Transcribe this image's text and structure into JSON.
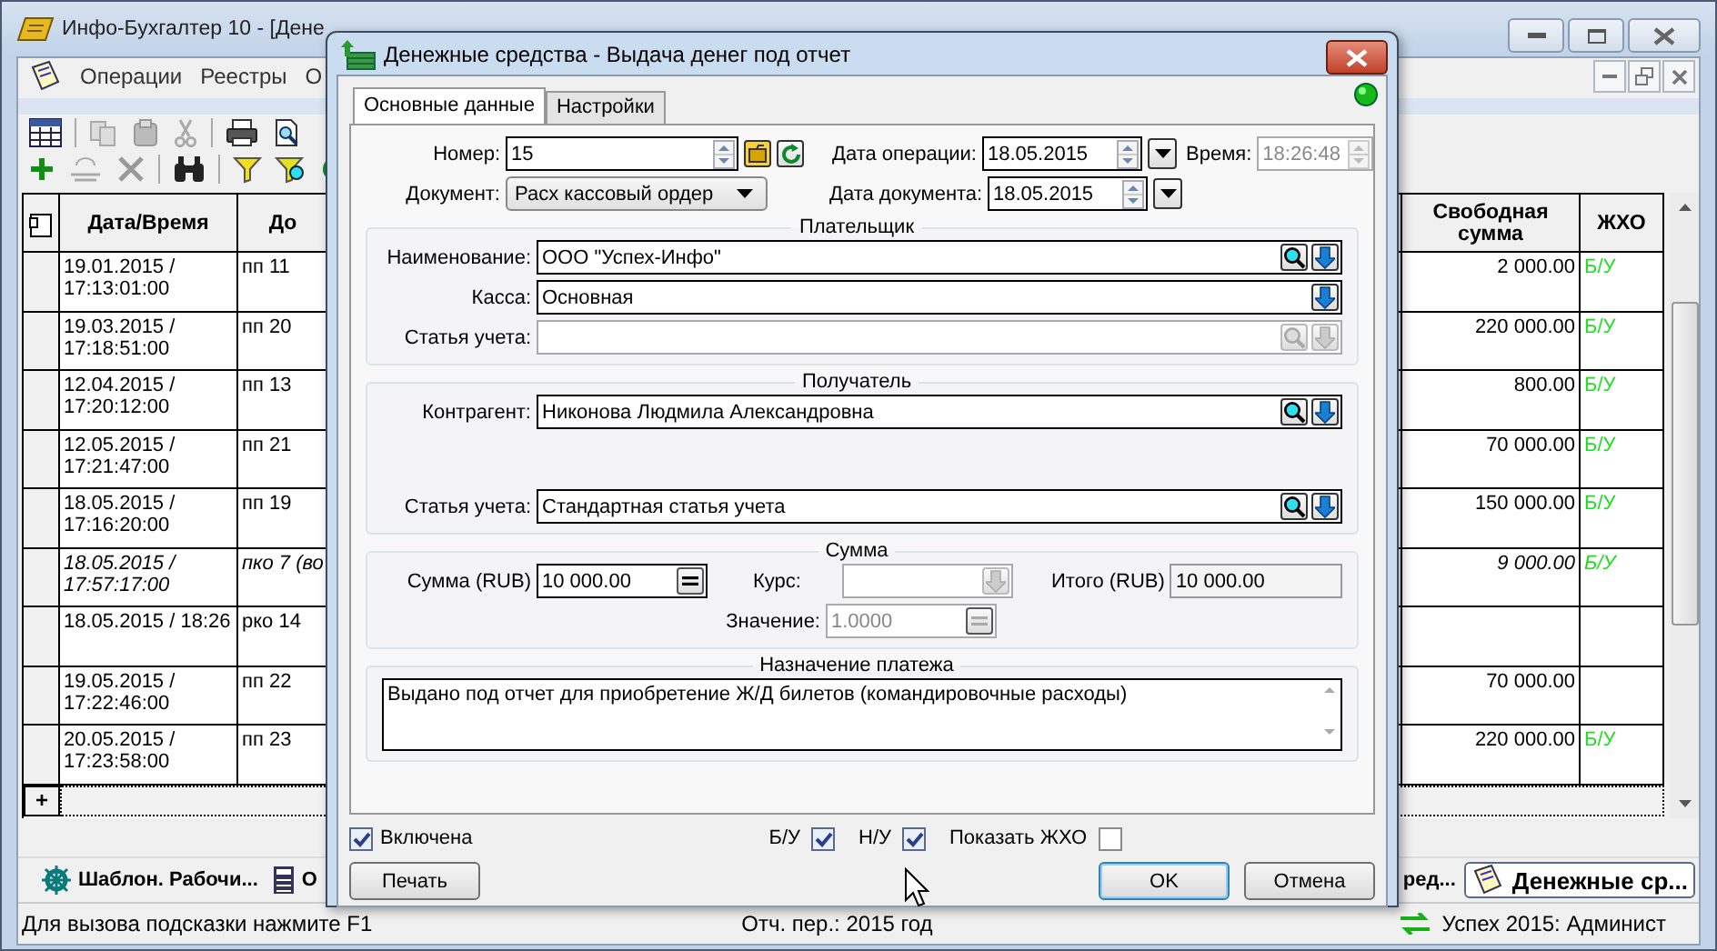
{
  "window": {
    "title": "Инфо-Бухгалтер 10 - [Дене"
  },
  "menu": [
    {
      "label": "Операции"
    },
    {
      "label": "Реестры"
    },
    {
      "label": "О"
    }
  ],
  "grid": {
    "columns": [
      "Дата/Время",
      "До",
      "Свободная сумма",
      "ЖХО"
    ],
    "rows": [
      {
        "datetime": "19.01.2015 / 17:13:01:00",
        "document": "пп 11",
        "free_sum": "2 000.00",
        "jho": "Б/У",
        "italic": false
      },
      {
        "datetime": "19.03.2015 / 17:18:51:00",
        "document": "пп 20",
        "free_sum": "220 000.00",
        "jho": "Б/У",
        "italic": false
      },
      {
        "datetime": "12.04.2015 / 17:20:12:00",
        "document": "пп 13",
        "free_sum": "800.00",
        "jho": "Б/У",
        "italic": false
      },
      {
        "datetime": "12.05.2015 / 17:21:47:00",
        "document": "пп 21",
        "free_sum": "70 000.00",
        "jho": "Б/У",
        "italic": false
      },
      {
        "datetime": "18.05.2015 / 17:16:20:00",
        "document": "пп 19",
        "free_sum": "150 000.00",
        "jho": "Б/У",
        "italic": false
      },
      {
        "datetime": "18.05.2015 / 17:57:17:00",
        "document": "пко 7 (во",
        "free_sum": "9 000.00",
        "jho": "Б/У",
        "italic": true
      },
      {
        "datetime": "18.05.2015 / 18:26",
        "document": "рко 14",
        "italic": false
      },
      {
        "datetime": "19.05.2015 / 17:22:46:00",
        "document": "пп 22",
        "free_sum": "70 000.00",
        "italic": false
      },
      {
        "datetime": "20.05.2015 / 17:23:58:00",
        "document": "пп 23",
        "free_sum": "220 000.00",
        "jho": "Б/У",
        "italic": false
      }
    ],
    "add_row": "+"
  },
  "taskbar": [
    {
      "label": "Шаблон. Рабочи...",
      "selected": false
    },
    {
      "label": "О",
      "selected": false
    },
    {
      "label": "ред...",
      "selected": false
    },
    {
      "label": "Денежные ср...",
      "selected": true
    }
  ],
  "status_bar": {
    "hint": "Для вызова подсказки нажмите F1",
    "period": "Отч. пер.: 2015 год",
    "database": "Успех 2015: Админист"
  },
  "dialog": {
    "title": "Денежные средства - Выдача денег под отчет",
    "tabs": [
      {
        "label": "Основные данные",
        "selected": true
      },
      {
        "label": "Настройки",
        "selected": false
      }
    ],
    "number": {
      "label": "Номер:",
      "value": "15"
    },
    "operation_date": {
      "label": "Дата операции:",
      "value": "18.05.2015"
    },
    "time": {
      "label": "Время:",
      "value": "18:26:48",
      "disabled": true
    },
    "document": {
      "label": "Документ:",
      "value": "Расх кассовый ордер"
    },
    "document_date": {
      "label": "Дата документа:",
      "value": "18.05.2015"
    },
    "payer": {
      "title": "Плательщик",
      "fields": [
        {
          "label": "Наименование:",
          "value": "ООО \"Успех-Инфо\"",
          "search": true,
          "disabled": false
        },
        {
          "label": "Касса:",
          "value": "Основная",
          "search": false,
          "disabled": false
        },
        {
          "label": "Статья учета:",
          "search": true,
          "disabled": true
        }
      ]
    },
    "recipient": {
      "title": "Получатель",
      "fields": [
        {
          "label": "Контрагент:",
          "value": "Никонова Людмила Александровна",
          "search": true,
          "disabled": false
        },
        {
          "label": "Статья учета:",
          "value": "Стандартная статья учета",
          "search": true,
          "disabled": false
        }
      ]
    },
    "amount": {
      "title": "Сумма",
      "amount": {
        "label": "Сумма (RUB)",
        "value": "10 000.00"
      },
      "rate": {
        "label": "Курс:",
        "disabled": true
      },
      "total": {
        "label": "Итого (RUB)",
        "value": "10 000.00"
      },
      "rate_value": {
        "label": "Значение:",
        "value": "1.0000",
        "disabled": true
      }
    },
    "purpose": {
      "title": "Назначение платежа",
      "value": "Выдано под отчет для приобретение Ж/Д билетов (командировочные расходы)"
    },
    "checks": [
      {
        "label": "Включена",
        "checked": true
      },
      {
        "label": "Б/У",
        "checked": true
      },
      {
        "label": "Н/У",
        "checked": true
      },
      {
        "label": "Показать ЖХО",
        "checked": false
      }
    ],
    "buttons": [
      {
        "label": "Печать",
        "default": false
      },
      {
        "label": "OK",
        "default": true
      },
      {
        "label": "Отмена",
        "default": false
      }
    ]
  }
}
